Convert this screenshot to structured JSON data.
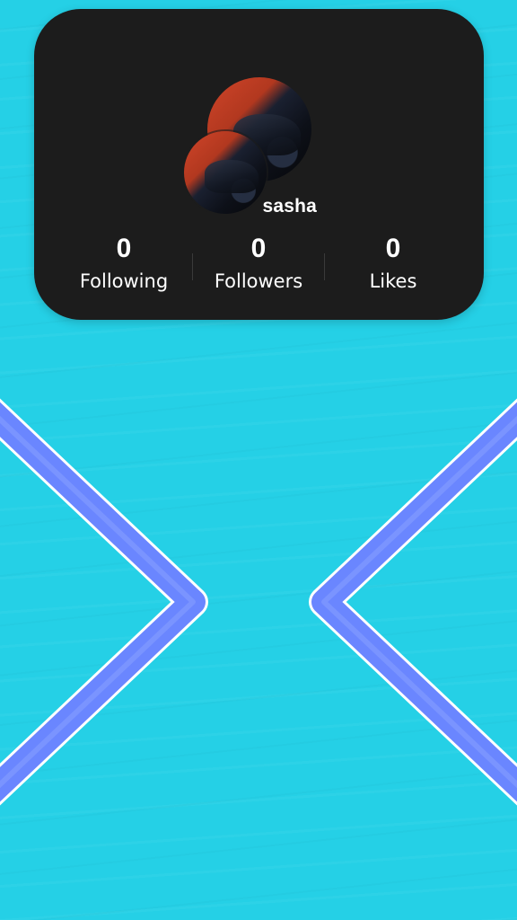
{
  "profile": {
    "username": "sasha"
  },
  "stats": {
    "following": {
      "value": "0",
      "label": "Following"
    },
    "followers": {
      "value": "0",
      "label": "Followers"
    },
    "likes": {
      "value": "0",
      "label": "Likes"
    }
  },
  "navigation": {
    "prev_icon": "chevron-left-icon",
    "next_icon": "chevron-right-icon"
  },
  "colors": {
    "background": "#25d0e6",
    "card": "#1c1c1c",
    "chevron_stroke": "#6a86ff",
    "chevron_outline": "#ffffff"
  }
}
